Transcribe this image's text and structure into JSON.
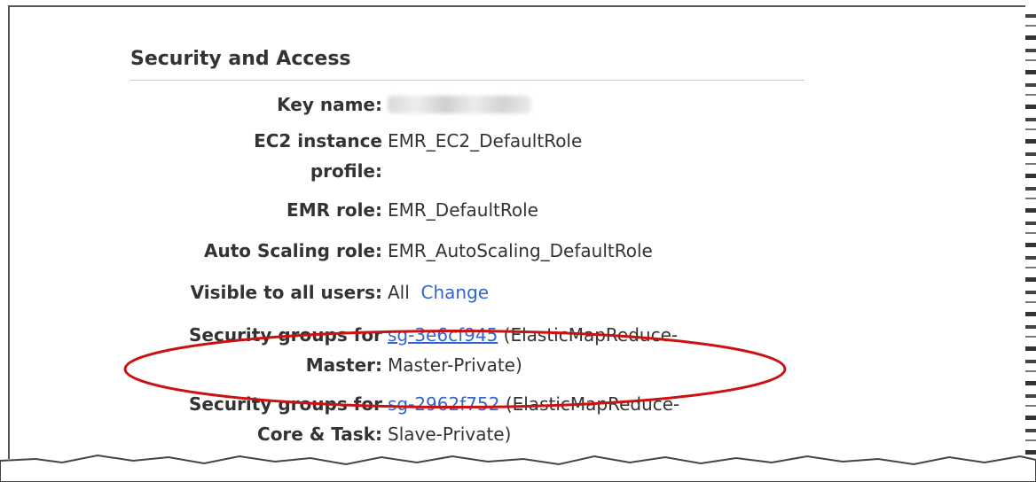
{
  "section": {
    "title": "Security and Access"
  },
  "fields": {
    "key_name": {
      "label": "Key name:"
    },
    "ec2_profile": {
      "label_line1": "EC2 instance",
      "label_line2": "profile:",
      "value": "EMR_EC2_DefaultRole"
    },
    "emr_role": {
      "label": "EMR role:",
      "value": "EMR_DefaultRole"
    },
    "autoscaling_role": {
      "label": "Auto Scaling role:",
      "value": "EMR_AutoScaling_DefaultRole"
    },
    "visible_all": {
      "label": "Visible to all users:",
      "value": "All",
      "link": "Change"
    },
    "sg_master": {
      "label_line1": "Security groups for",
      "label_line2": "Master:",
      "link": "sg-3e6cf945",
      "value_line1": "(ElasticMapReduce-",
      "value_line2": "Master-Private)"
    },
    "sg_core": {
      "label_line1": "Security groups for",
      "label_line2": "Core & Task:",
      "link": "sg-2962f752",
      "value_line1": "(ElasticMapReduce-",
      "value_line2": "Slave-Private)"
    }
  },
  "colors": {
    "link": "#3366cc",
    "highlight": "#cc1111",
    "text": "#333333"
  }
}
